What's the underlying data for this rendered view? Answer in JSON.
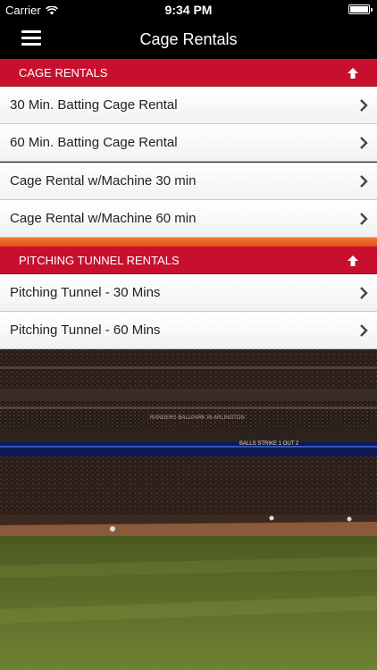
{
  "status_bar": {
    "carrier": "Carrier",
    "time": "9:34 PM",
    "battery_level": 1.0
  },
  "nav": {
    "title": "Cage Rentals"
  },
  "sections": [
    {
      "header": "CAGE RENTALS",
      "items": [
        "30 Min. Batting Cage Rental",
        "60 Min. Batting Cage Rental",
        "Cage Rental w/Machine 30 min",
        "Cage Rental w/Machine 60 min"
      ]
    },
    {
      "header": "PITCHING TUNNEL RENTALS",
      "items": [
        "Pitching Tunnel - 30 Mins",
        "Pitching Tunnel - 60 Mins"
      ]
    }
  ],
  "background": {
    "scoreboard_text": "BALLS  STRIKE 1  OUT 2",
    "facade_text": "RANGERS BALLPARK IN ARLINGTON"
  },
  "colors": {
    "accent": "#c8102e",
    "bar": "#000000"
  }
}
